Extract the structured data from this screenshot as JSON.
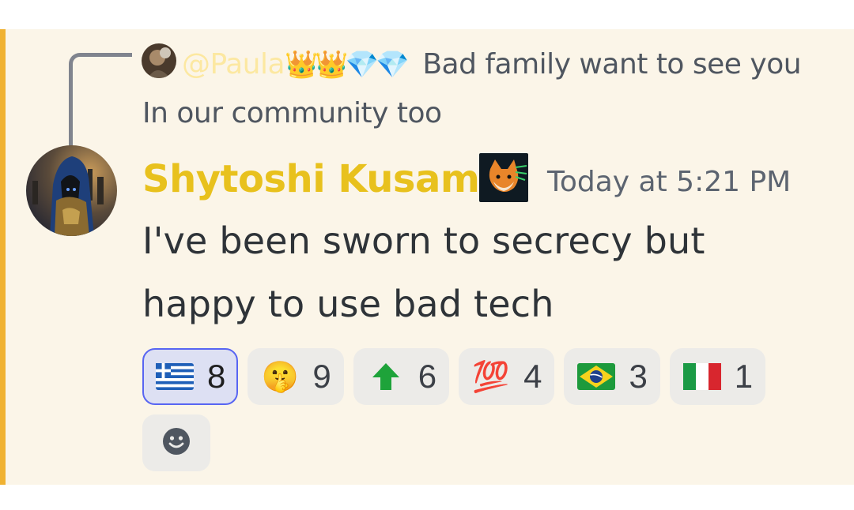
{
  "reply": {
    "mention": "@Paula",
    "emojis": "👑👑💎💎",
    "text": "Bad family  want to see you In our community  too"
  },
  "message": {
    "author": "Shytoshi Kusama",
    "author_color": "#e8c11d",
    "timestamp": "Today at 5:21 PM",
    "content": "I've been sworn to secrecy but happy to use bad tech"
  },
  "reactions": [
    {
      "emoji": "greece-flag",
      "count": "8",
      "me": true
    },
    {
      "emoji": "🤫",
      "count": "9",
      "me": false
    },
    {
      "emoji": "up-arrow",
      "count": "6",
      "me": false
    },
    {
      "emoji": "💯",
      "count": "4",
      "me": false
    },
    {
      "emoji": "brazil-flag",
      "count": "3",
      "me": false
    },
    {
      "emoji": "italy-flag",
      "count": "1",
      "me": false
    }
  ],
  "colors": {
    "highlight_bg": "#fbf5e8",
    "accent": "#f0b232",
    "reacted_border": "#5865f2"
  }
}
